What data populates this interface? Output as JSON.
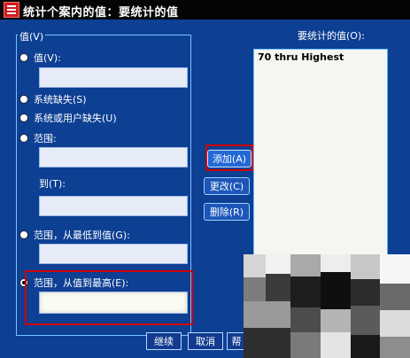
{
  "window": {
    "title": "统计个案内的值：要统计的值"
  },
  "group": {
    "label": "值(V)"
  },
  "options": {
    "value_label": "值(V):",
    "system_missing_label": "系统缺失(S)",
    "system_or_user_missing_label": "系统或用户缺失(U)",
    "range_label": "范围:",
    "to_label": "到(T):",
    "lowest_to_value_label": "范围，从最低到值(G):",
    "value_to_highest_label": "范围，从值到最高(E):"
  },
  "buttons": {
    "add": "添加(A)",
    "change": "更改(C)",
    "remove": "删除(R)"
  },
  "list": {
    "header": "要统计的值(O):",
    "items": [
      "70 thru Highest"
    ]
  },
  "bottom_buttons": [
    "继续",
    "取消",
    "帮"
  ]
}
